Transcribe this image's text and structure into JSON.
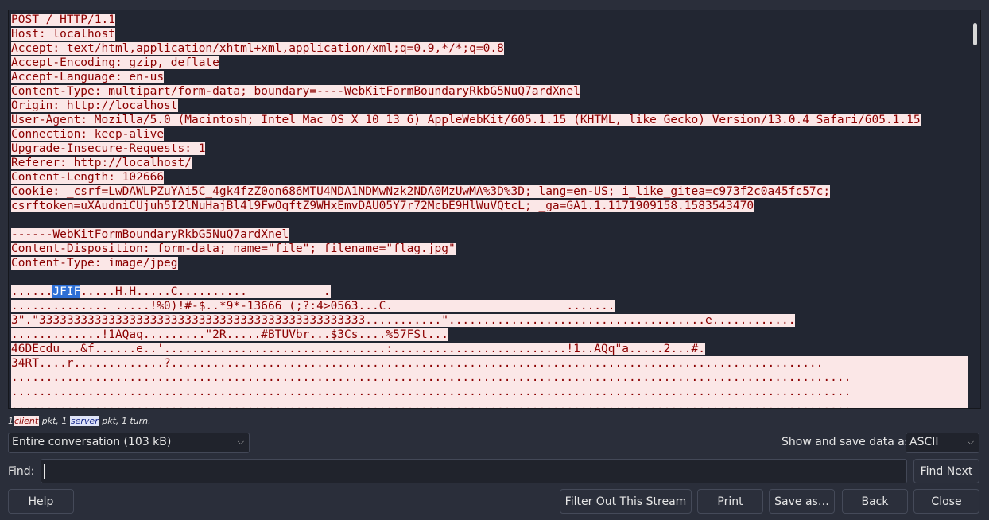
{
  "stream": {
    "lines": [
      "POST / HTTP/1.1",
      "Host: localhost",
      "Accept: text/html,application/xhtml+xml,application/xml;q=0.9,*/*;q=0.8",
      "Accept-Encoding: gzip, deflate",
      "Accept-Language: en-us",
      "Content-Type: multipart/form-data; boundary=----WebKitFormBoundaryRkbG5NuQ7ardXnel",
      "Origin: http://localhost",
      "User-Agent: Mozilla/5.0 (Macintosh; Intel Mac OS X 10_13_6) AppleWebKit/605.1.15 (KHTML, like Gecko) Version/13.0.4 Safari/605.1.15",
      "Connection: keep-alive",
      "Upgrade-Insecure-Requests: 1",
      "Referer: http://localhost/",
      "Content-Length: 102666",
      "Cookie: _csrf=LwDAWLPZuYAi5C_4gk4fzZ0on686MTU4NDA1NDMwNzk2NDA0MzUwMA%3D%3D; lang=en-US; i_like_gitea=c973f2c0a45fc57c;",
      "csrftoken=uXAudniCUjuh5I2lNuHajBl4l9FwOqftZ9WHxEmvDAU05Y7r72McbE9HlWuVQtcL; _ga=GA1.1.1171909158.1583543470",
      "",
      "------WebKitFormBoundaryRkbG5NuQ7ardXnel",
      "Content-Disposition: form-data; name=\"file\"; filename=\"flag.jpg\"",
      "Content-Type: image/jpeg",
      "",
      "......",
      "JFIF",
      ".....H.H.....C..........           .",
      ".............. .....!%0)!#-$..*9*-13666 (;?:4>0563...C.                         .......",
      "3\".\"33333333333333333333333333333333333333333333333...........\".....................................e............",
      ".............!1AQaq.........\"2R.....#BTUVbr...$3Cs....%57FSt...",
      "46DEcdu...&f......e..'................................:.........................!1..AQq\"a.....2...#.",
      "34RT....r.............?..............................................................................................",
      ".........................................................................................................................",
      ".........................................................................................................................",
      "........................................................................................................................."
    ]
  },
  "legend": {
    "count_client": "1",
    "client_label": "client",
    "pkt_sep": "pkt, 1",
    "server_label": "server",
    "tail": "pkt, 1 turn."
  },
  "conversation_select": {
    "value": "Entire conversation (103 kB)"
  },
  "show_save": {
    "label": "Show and save data as",
    "value": "ASCII"
  },
  "find": {
    "label": "Find:",
    "value": "",
    "next_label": "Find Next"
  },
  "buttons": {
    "help": "Help",
    "filter_out": "Filter Out This Stream",
    "print": "Print",
    "save_as": "Save as…",
    "back": "Back",
    "close": "Close"
  },
  "colors": {
    "client_bg": "#fbe7e7",
    "client_fg": "#8b0000",
    "server_bg": "#dfe4f7",
    "highlight": "#2d6fd6"
  },
  "icons": {
    "dropdown": "chevron-down-icon"
  }
}
